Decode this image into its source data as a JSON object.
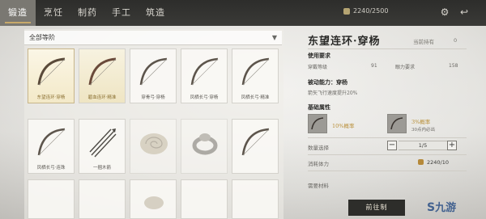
{
  "tabs": [
    {
      "label": "锻造",
      "active": true
    },
    {
      "label": "烹饪",
      "active": false
    },
    {
      "label": "制药",
      "active": false
    },
    {
      "label": "手工",
      "active": false
    },
    {
      "label": "筑造",
      "active": false
    }
  ],
  "header": {
    "stamina": "2240/2500",
    "icons": [
      "stamina-icon",
      "settings-icon",
      "back-icon"
    ]
  },
  "filter": {
    "label": "全部等阶"
  },
  "items": [
    {
      "name": "东望连环·穿杨",
      "icon": "bow-icon",
      "state": "selected"
    },
    {
      "name": "碧血连环·精准",
      "icon": "bow-icon",
      "state": "gold"
    },
    {
      "name": "穿骨弓·穿杨",
      "icon": "bow-icon",
      "state": "normal"
    },
    {
      "name": "凤栖长弓·穿杨",
      "icon": "bow-icon",
      "state": "normal"
    },
    {
      "name": "凤栖长弓·精准",
      "icon": "bow-icon",
      "state": "normal"
    },
    {
      "name": "凤栖长弓·连珠",
      "icon": "bow-icon",
      "state": "normal"
    },
    {
      "name": "一捆木箭",
      "icon": "arrows-icon",
      "state": "normal"
    },
    {
      "name": "",
      "icon": "shell-icon",
      "state": "dim"
    },
    {
      "name": "",
      "icon": "ring-icon",
      "state": "dim"
    },
    {
      "name": "",
      "icon": "bow-icon",
      "state": "normal"
    }
  ],
  "detail": {
    "title": "东望连环·穿杨",
    "owned_label": "当前持有",
    "owned_value": "0",
    "requirements_heading": "使用要求",
    "req_left_label": "穿戴等级",
    "req_left_value": "91",
    "req_right_label": "眼力要求",
    "req_right_value": "158",
    "passive_heading": "被动能力：穿杨",
    "passive_text": "箭矢飞行速度提升20%",
    "base_heading": "基础属性",
    "attr1": "10%概率",
    "attr2": "3%概率",
    "attr2_sub": "30点内必出",
    "qty_label": "数量选择",
    "qty_value": "1/5",
    "minus": "−",
    "plus": "+",
    "cost_label": "消耗体力",
    "cost_value": "2240/10",
    "materials_label": "需要材料",
    "goto_button": "前往制",
    "watermark": "九游"
  },
  "colors": {
    "accent_gold": "#c8a96a",
    "topbar": "#2d2d2b",
    "active_tab": "#7a7872",
    "watermark": "#2a4f86"
  }
}
